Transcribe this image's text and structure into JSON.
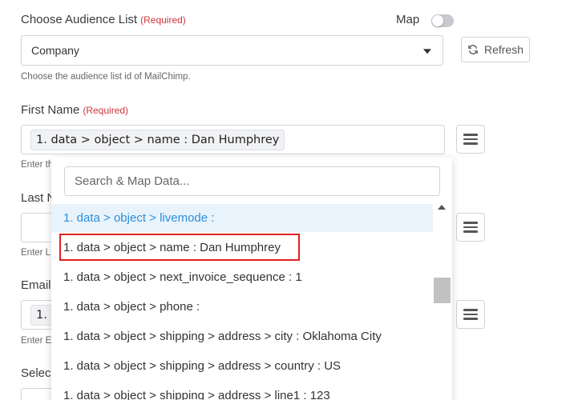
{
  "audience": {
    "label": "Choose Audience List",
    "required": "(Required)",
    "map_label": "Map",
    "selected": "Company",
    "hint": "Choose the audience list id of MailChimp.",
    "refresh_label": "Refresh"
  },
  "first_name": {
    "label": "First Name",
    "required": "(Required)",
    "token": "1. data > object > name : Dan Humphrey",
    "hint_partial": "Enter th"
  },
  "last_name": {
    "label_partial": "Last N",
    "hint_partial": "Enter L"
  },
  "email": {
    "label_partial": "Email",
    "token_partial": "1.",
    "hint_partial": "Enter E"
  },
  "select_partial": "Selec",
  "dropdown": {
    "search_placeholder": "Search & Map Data...",
    "options": [
      "1. data > object > livemode :",
      "1. data > object > name : Dan Humphrey",
      "1. data > object > next_invoice_sequence : 1",
      "1. data > object > phone :",
      "1. data > object > shipping > address > city : Oklahoma City",
      "1. data > object > shipping > address > country : US",
      "1. data > object > shipping > address > line1 : 123"
    ]
  },
  "colors": {
    "required": "#d0343a",
    "highlight_bg": "#e9f3fb",
    "highlight_text": "#2a8fdc",
    "annotation_box": "#e02020"
  }
}
